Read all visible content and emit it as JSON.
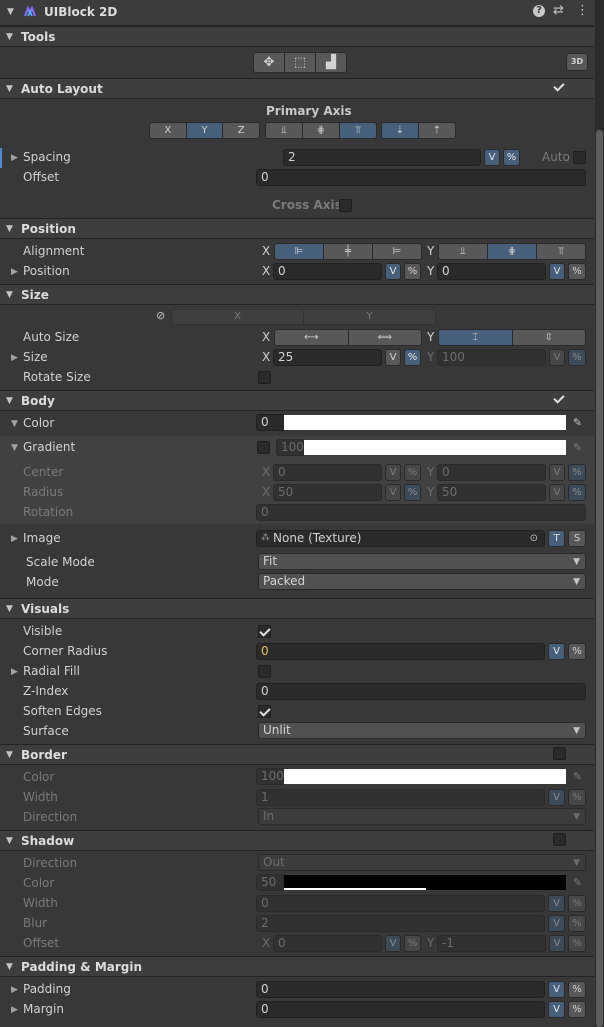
{
  "window": {
    "title": "UIBlock 2D",
    "help": "?",
    "settings": "⇄",
    "menu": "⋮"
  },
  "tools": {
    "title": "Tools",
    "mode_3d": "3D"
  },
  "auto_layout": {
    "title": "Auto Layout",
    "primary_axis": "Primary Axis",
    "axes": [
      "X",
      "Y",
      "Z"
    ],
    "spacing_label": "Spacing",
    "spacing_value": "2",
    "spacing_v": "V",
    "spacing_pct": "%",
    "auto_label": "Auto",
    "offset_label": "Offset",
    "offset_value": "0",
    "cross_axis": "Cross Axis"
  },
  "position": {
    "title": "Position",
    "alignment_label": "Alignment",
    "x": "X",
    "y": "Y",
    "position_label": "Position",
    "pos_x": "0",
    "pos_y": "0",
    "v": "V",
    "pct": "%"
  },
  "size": {
    "title": "Size",
    "col_x": "X",
    "col_y": "Y",
    "auto_size_label": "Auto Size",
    "size_label": "Size",
    "size_x": "25",
    "size_y": "100",
    "rotate_label": "Rotate Size"
  },
  "body": {
    "title": "Body",
    "color_label": "Color",
    "color_alpha": "0",
    "gradient_label": "Gradient",
    "gradient_alpha": "100",
    "center_label": "Center",
    "center_x": "0",
    "center_y": "0",
    "radius_label": "Radius",
    "radius_x": "50",
    "radius_y": "50",
    "rotation_label": "Rotation",
    "rotation_value": "0",
    "image_label": "Image",
    "image_value": "None (Texture)",
    "t": "T",
    "s": "S",
    "scale_mode_label": "Scale Mode",
    "scale_mode_value": "Fit",
    "mode_label": "Mode",
    "mode_value": "Packed"
  },
  "visuals": {
    "title": "Visuals",
    "visible_label": "Visible",
    "corner_label": "Corner Radius",
    "corner_value": "0",
    "radial_label": "Radial Fill",
    "zindex_label": "Z-Index",
    "zindex_value": "0",
    "soften_label": "Soften Edges",
    "surface_label": "Surface",
    "surface_value": "Unlit"
  },
  "border": {
    "title": "Border",
    "color_label": "Color",
    "color_alpha": "100",
    "width_label": "Width",
    "width_value": "1",
    "direction_label": "Direction",
    "direction_value": "In"
  },
  "shadow": {
    "title": "Shadow",
    "direction_label": "Direction",
    "direction_value": "Out",
    "color_label": "Color",
    "color_alpha": "50",
    "width_label": "Width",
    "width_value": "0",
    "blur_label": "Blur",
    "blur_value": "2",
    "offset_label": "Offset",
    "offset_x": "0",
    "offset_y": "-1"
  },
  "padding_margin": {
    "title": "Padding & Margin",
    "padding_label": "Padding",
    "padding_value": "0",
    "margin_label": "Margin",
    "margin_value": "0"
  }
}
